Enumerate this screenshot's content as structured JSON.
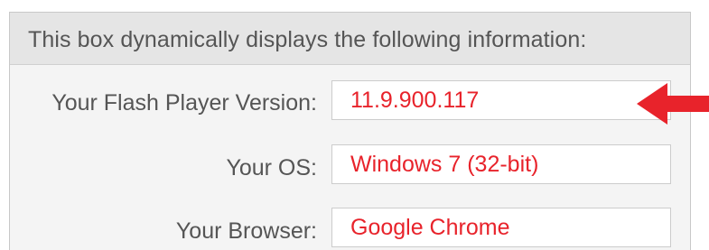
{
  "info_box": {
    "header": "This box dynamically displays the following information:",
    "rows": [
      {
        "label": "Your Flash Player Version:",
        "value": "11.9.900.117"
      },
      {
        "label": "Your OS:",
        "value": "Windows 7 (32-bit)"
      },
      {
        "label": "Your Browser:",
        "value": "Google Chrome"
      }
    ]
  },
  "annotation": {
    "icon": "arrow-left-icon",
    "color": "#e8232b"
  },
  "colors": {
    "value_text": "#e8232b",
    "label_text": "#555555",
    "header_bg": "#e5e5e5",
    "box_bg": "#f4f4f4"
  }
}
